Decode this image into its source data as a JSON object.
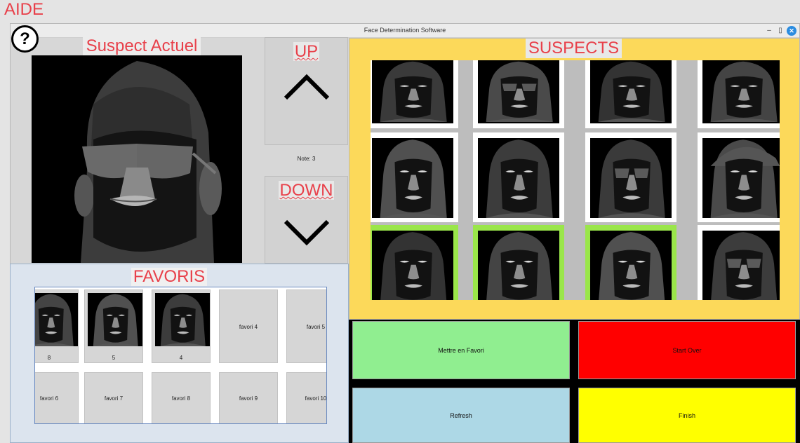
{
  "aide_label": "AIDE",
  "window": {
    "title": "Face Determination Software",
    "min_glyph": "–",
    "max_glyph": "▯",
    "close_glyph": "✕"
  },
  "help_glyph": "?",
  "current_suspect": {
    "title": "Suspect Actuel"
  },
  "up_button": {
    "label": "UP"
  },
  "down_button": {
    "label": "DOWN"
  },
  "note": "Note: 3",
  "favoris": {
    "title": "FAVORIS",
    "items": [
      {
        "label": "8",
        "has_photo": true
      },
      {
        "label": "5",
        "has_photo": true
      },
      {
        "label": "4",
        "has_photo": true
      },
      {
        "label": "favori 4",
        "has_photo": false
      },
      {
        "label": "favori 5",
        "has_photo": false
      },
      {
        "label": "favori 6",
        "has_photo": false
      },
      {
        "label": "favori 7",
        "has_photo": false
      },
      {
        "label": "favori 8",
        "has_photo": false
      },
      {
        "label": "favori 9",
        "has_photo": false
      },
      {
        "label": "favori 10",
        "has_photo": false
      }
    ]
  },
  "suspects": {
    "title": "SUSPECTS",
    "rows": [
      [
        {
          "favorite": false
        },
        {
          "favorite": false
        },
        {
          "favorite": false
        },
        {
          "favorite": false
        }
      ],
      [
        {
          "favorite": false
        },
        {
          "favorite": false
        },
        {
          "favorite": false
        },
        {
          "favorite": false
        }
      ],
      [
        {
          "favorite": true
        },
        {
          "favorite": true
        },
        {
          "favorite": true
        },
        {
          "favorite": false
        }
      ]
    ]
  },
  "actions": {
    "favori": "Mettre en Favori",
    "start_over": "Start Over",
    "refresh": "Refresh",
    "finish": "Finish"
  },
  "colors": {
    "label_red": "#e8404a",
    "suspects_bg": "#fcd95a",
    "favorite_border": "#9ae64a",
    "favori_btn": "#90ee90",
    "start_over_btn": "#ff0000",
    "refresh_btn": "#add8e6",
    "finish_btn": "#ffff00"
  }
}
